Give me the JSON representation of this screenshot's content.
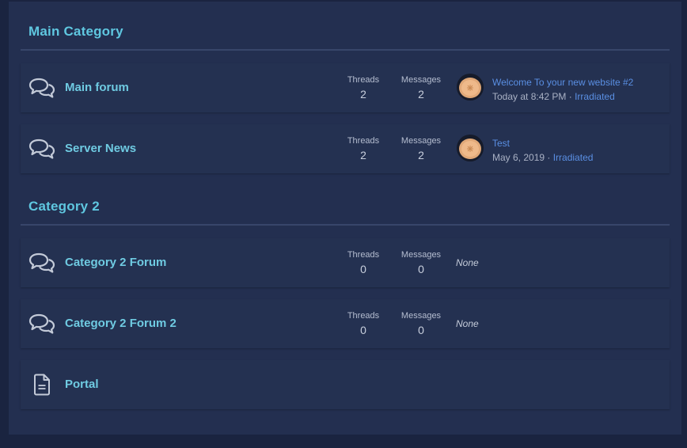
{
  "categories": [
    {
      "title": "Main Category",
      "forums": [
        {
          "name": "Main forum",
          "threads_label": "Threads",
          "threads": "2",
          "messages_label": "Messages",
          "messages": "2",
          "last_post_title": "Welcome To your new website #2",
          "last_post_time": "Today at 8:42 PM",
          "separator": " · ",
          "last_post_user": "Irradiated"
        },
        {
          "name": "Server News",
          "threads_label": "Threads",
          "threads": "2",
          "messages_label": "Messages",
          "messages": "2",
          "last_post_title": "Test",
          "last_post_time": "May 6, 2019",
          "separator": " · ",
          "last_post_user": "Irradiated"
        }
      ]
    },
    {
      "title": "Category 2",
      "forums": [
        {
          "name": "Category 2 Forum",
          "threads_label": "Threads",
          "threads": "0",
          "messages_label": "Messages",
          "messages": "0",
          "last_post": "None"
        },
        {
          "name": "Category 2 Forum 2",
          "threads_label": "Threads",
          "threads": "0",
          "messages_label": "Messages",
          "messages": "0",
          "last_post": "None"
        }
      ],
      "page": {
        "name": "Portal"
      }
    }
  ],
  "icons": {
    "forum": "comments-icon",
    "page": "document-icon",
    "avatar": "avatar"
  },
  "colors": {
    "background": "#1a2440",
    "panel": "#232f50",
    "category_title": "#5fc7e0",
    "forum_name": "#6fcbe2",
    "link": "#5a8fe3"
  }
}
